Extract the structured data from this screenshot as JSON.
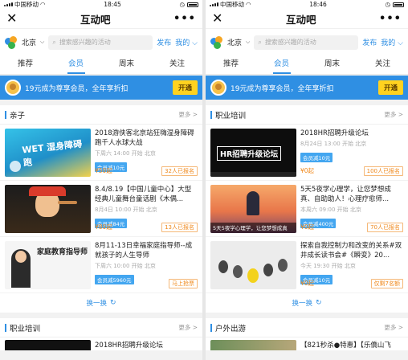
{
  "status": {
    "carrier": "中国移动",
    "time": "18:45",
    "time_right": "18:46"
  },
  "nav": {
    "title": "互动吧",
    "close_glyph": "✕",
    "more_glyph": "•••"
  },
  "search": {
    "city": "北京",
    "placeholder": "搜索感兴趣的活动",
    "publish": "发布",
    "mine": "我的"
  },
  "tabs": [
    "推荐",
    "会员",
    "周末",
    "关注"
  ],
  "banner": {
    "text": "19元成为尊享会员，全年享折扣",
    "button": "开通"
  },
  "left": {
    "section1": {
      "title": "亲子",
      "more": "更多 >",
      "items": [
        {
          "title": "2018游侠客北京站狂嗨湿身障碍跑千人水球大战",
          "meta": "下周六 14:00 开始  北京",
          "tag": "会员减10元",
          "price": "¥50起",
          "status": "32人已报名",
          "thumb_text": "WET 湿身障碍跑"
        },
        {
          "title": "8.4/8.19【中国儿童中心】大型经典儿童舞台童话剧《木偶...",
          "meta": "8月4日 10:00 开始  北京",
          "tag": "会员减84元",
          "price": "¥80起",
          "status": "13人已报名",
          "thumb_text": ""
        },
        {
          "title": "8月11-13日幸福家庭指导师--成就孩子的人生导师",
          "meta": "下周六 10:00 开始  北京",
          "tag": "会员减5960元",
          "price": "",
          "status": "马上抢票",
          "thumb_text": "家庭教育指导师"
        }
      ]
    },
    "swap": "换一换",
    "section2": {
      "title": "职业培训",
      "more": "更多 >",
      "partial_title": "2018HR招聘升级论坛"
    }
  },
  "right": {
    "section1": {
      "title": "职业培训",
      "more": "更多 >",
      "items": [
        {
          "title": "2018HR招聘升级论坛",
          "meta": "8月24日 13:00 开始  北京",
          "tag": "会员减10元",
          "price": "¥0起",
          "status": "100人已报名",
          "thumb_text": "HR招聘升级论坛"
        },
        {
          "title": "5天5夜学心理学，让您梦想成真、自助助人！心理疗愈师...",
          "meta": "本周六 09:00 开始  北京",
          "tag": "会员减400元",
          "price": "¥0起",
          "status": "70人已报名",
          "thumb_text": "5天5夜学心理学，让您梦想成真"
        },
        {
          "title": "探索自我控制力和改变的关系#双井成长读书会#《瞬变》20...",
          "meta": "今天 19:30 开始  北京",
          "tag": "会员减10元",
          "price": "¥0起",
          "status": "仅剩7名额",
          "thumb_text": ""
        }
      ]
    },
    "swap": "换一换",
    "section2": {
      "title": "户外出游",
      "more": "更多 >",
      "partial_title": "【821秒杀●特惠】【乐僑山飞"
    }
  },
  "colors": {
    "brand": "#2f8fe3",
    "price": "#f08a1e",
    "vip_button": "#ffd21f"
  }
}
